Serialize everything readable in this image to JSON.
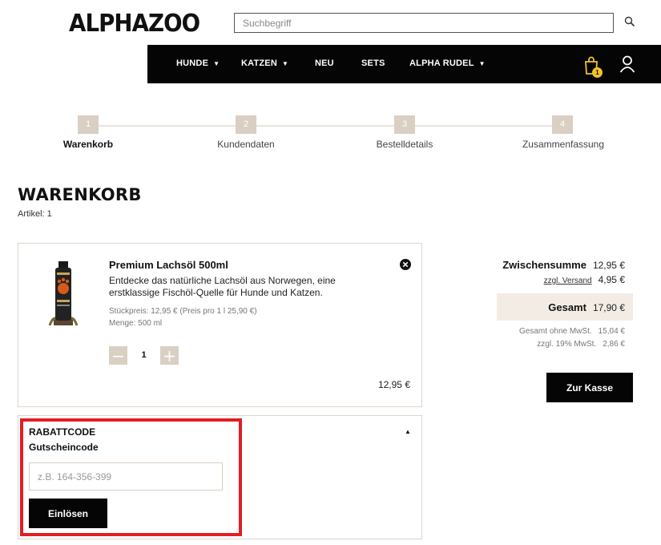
{
  "header": {
    "logo": "ALPHAZOO",
    "search_placeholder": "Suchbegriff",
    "cart_count": "1"
  },
  "nav": {
    "items": [
      {
        "label": "HUNDE",
        "dropdown": true
      },
      {
        "label": "KATZEN",
        "dropdown": true
      },
      {
        "label": "NEU",
        "dropdown": false
      },
      {
        "label": "SETS",
        "dropdown": false
      },
      {
        "label": "ALPHA RUDEL",
        "dropdown": true
      }
    ]
  },
  "steps": [
    {
      "number": "1",
      "label": "Warenkorb",
      "active": true
    },
    {
      "number": "2",
      "label": "Kundendaten",
      "active": false
    },
    {
      "number": "3",
      "label": "Bestelldetails",
      "active": false
    },
    {
      "number": "4",
      "label": "Zusammenfassung",
      "active": false
    }
  ],
  "page": {
    "title": "WARENKORB",
    "article_count": "Artikel: 1"
  },
  "product": {
    "name": "Premium Lachsöl 500ml",
    "description": "Entdecke das natürliche Lachsöl aus Norwegen, eine erstklassige Fischöl-Quelle für Hunde und Katzen.",
    "unit_price": "Stückpreis: 12,95 € (Preis pro 1 l 25,90 €)",
    "quantity_info": "Menge: 500 ml",
    "quantity": "1",
    "price": "12,95 €"
  },
  "coupon": {
    "title": "RABATTCODE",
    "subtitle": "Gutscheincode",
    "placeholder": "z.B. 164-356-399",
    "button_label": "Einlösen"
  },
  "summary": {
    "subtotal_label": "Zwischensumme",
    "subtotal_value": "12,95 €",
    "shipping_label": "zzgl. Versand",
    "shipping_value": "4,95 €",
    "total_label": "Gesamt",
    "total_value": "17,90 €",
    "net_label": "Gesamt ohne MwSt.",
    "net_value": "15,04 €",
    "vat_label": "zzgl. 19% MwSt.",
    "vat_value": "2,86 €",
    "checkout_label": "Zur Kasse"
  },
  "colors": {
    "accent_beige": "#d9cfc3",
    "total_band": "#f3ece4",
    "highlight_red": "#e01e24",
    "cart_badge": "#f2c22a"
  }
}
